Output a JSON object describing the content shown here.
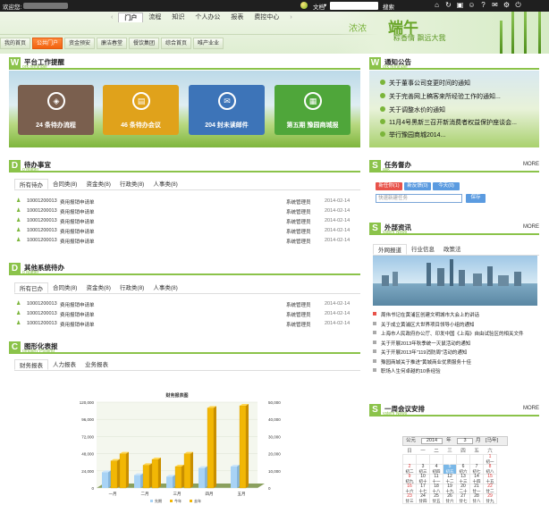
{
  "topbar": {
    "welcome": "欢迎您:",
    "doc_label": "文档",
    "search_button": "搜索"
  },
  "nav": {
    "items": [
      "门户",
      "流程",
      "知识",
      "个人办公",
      "报表",
      "费控中心"
    ]
  },
  "subnav": {
    "items": [
      "我的首页",
      "公共门户",
      "资金预安",
      "廉洁春堂",
      "餐饮集团",
      "综合首页",
      "唯产业业"
    ]
  },
  "logo": {
    "line1": "浓浓",
    "line2": "端午",
    "line3": "粽香情 飘远大我"
  },
  "reminder": {
    "title": "平台工作提醒",
    "subtitle": "ork reminder",
    "badge": "W",
    "tiles": [
      {
        "label": "24 条待办流程",
        "color": "#7a5f4e",
        "icon": "layers-icon",
        "glyph": "◈"
      },
      {
        "label": "46 条待办会议",
        "color": "#e0a21b",
        "icon": "chat-icon",
        "glyph": "▤"
      },
      {
        "label": "204 封未读邮件",
        "color": "#3d74b8",
        "icon": "mail-icon",
        "glyph": "✉"
      },
      {
        "label": "第五期 豫园商城报",
        "color": "#4fa63a",
        "icon": "book-icon",
        "glyph": "▦"
      }
    ]
  },
  "notice": {
    "title": "通知公告",
    "subtitle": "ork reminder",
    "badge": "W",
    "items": [
      "关于董事公司变更时间的通知",
      "关于完善网上稿客来所经验工作的通知...",
      "关于调整水价的通知",
      "11月4号黑新三召开新消费者权益保护座谈会...",
      "举行豫园商城2014..."
    ]
  },
  "todo": {
    "title": "待办事宜",
    "subtitle": "o Matter",
    "badge": "D",
    "tabs": [
      "所有待办",
      "合同类(8)",
      "资金类(8)",
      "行政类(8)",
      "人事类(8)"
    ],
    "rows": [
      {
        "code": "10001200013",
        "desc": "费用报销申请单",
        "who": "系统管理员",
        "date": "2014-02-14"
      },
      {
        "code": "10001200013",
        "desc": "费用报销申请单",
        "who": "系统管理员",
        "date": "2014-02-14"
      },
      {
        "code": "10001200013",
        "desc": "费用报销申请单",
        "who": "系统管理员",
        "date": "2014-02-14"
      },
      {
        "code": "10001200013",
        "desc": "费用报销申请单",
        "who": "系统管理员",
        "date": "2014-02-14"
      },
      {
        "code": "10001200013",
        "desc": "费用报销申请单",
        "who": "系统管理员",
        "date": "2014-02-14"
      }
    ]
  },
  "other": {
    "title": "其他系统待办",
    "subtitle": "o Matter",
    "badge": "D",
    "tabs": [
      "所有已办",
      "合同类(8)",
      "资金类(8)",
      "行政类(8)",
      "人事类(8)"
    ],
    "rows": [
      {
        "code": "10001200013",
        "desc": "费用报销申请单",
        "who": "系统管理员",
        "date": "2014-02-14"
      },
      {
        "code": "10001200013",
        "desc": "费用报销申请单",
        "who": "系统管理员",
        "date": "2014-02-14"
      },
      {
        "code": "10001200013",
        "desc": "费用报销申请单",
        "who": "系统管理员",
        "date": "2014-02-14"
      }
    ]
  },
  "graph": {
    "title": "图形化表报",
    "subtitle": "ompany Posting",
    "badge": "C",
    "tabs": [
      "财务报表",
      "人力报表",
      "业务报表"
    ]
  },
  "chart_data": {
    "type": "bar",
    "title": "财务报表图",
    "categories": [
      "一月",
      "二月",
      "三月",
      "四月",
      "五月"
    ],
    "series": [
      {
        "name": "先期",
        "values": [
          22000,
          18000,
          16000,
          28000,
          30000
        ],
        "color": "#a8d3f5"
      },
      {
        "name": "今年",
        "values": [
          38000,
          32000,
          30000,
          112000,
          115000
        ],
        "color": "#f2b705"
      },
      {
        "name": "去年",
        "values": [
          48000,
          40000,
          48000,
          0,
          0
        ],
        "color": "#f2b705"
      }
    ],
    "legend": [
      "先期",
      "今年",
      "去年"
    ],
    "left_ticks": [
      "120,000",
      "96,000",
      "72,000",
      "48,000",
      "24,000",
      "0"
    ],
    "right_ticks": [
      "50,000",
      "40,000",
      "30,000",
      "20,000",
      "10,000",
      "0"
    ],
    "ylim": [
      0,
      120000
    ],
    "legend_position": "bottom"
  },
  "task": {
    "title": "任务督办",
    "subtitle": "ask",
    "badge": "S",
    "more": "MORE",
    "pills": [
      "新任你(1)",
      "新反馈(0)",
      "今天(0)"
    ],
    "input_placeholder": "快速新建任务",
    "save": "保存"
  },
  "outside": {
    "title": "外部资讯",
    "subtitle": "ystem News",
    "badge": "S",
    "more": "MORE",
    "tabs": [
      "外网报道",
      "行业信息",
      "政策法"
    ],
    "news": [
      "周伟书记在黄浦区创建文明城市大会上的讲话",
      "关于成立黄浦区大世界项目领导小组的通知",
      "上海市人民政府办公厅、印发中国《上海》自由试验区的相关文件",
      "关于开展2013年秋季统一灭鼠活动的通知",
      "关于开展2013年\"119消防周\"活动的通知",
      "豫园商城关于推进\"黄城商业优质服务十佳",
      "职场人生何卓越的10条经验"
    ]
  },
  "meeting": {
    "title": "一周会议安排",
    "subtitle": "ystem News",
    "badge": "S",
    "more": "MORE",
    "cal_header": {
      "prefix": "公元",
      "year": "2014",
      "year_unit": "年",
      "month": "3",
      "month_unit": "月",
      "extra": "[马年]"
    },
    "weekdays": [
      "日",
      "一",
      "二",
      "三",
      "四",
      "五",
      "六"
    ],
    "weeks": [
      [
        "",
        "",
        "",
        "",
        "",
        "",
        "1 初一"
      ],
      [
        "2 初二",
        "3 初三",
        "4 初四",
        "5 初五",
        "6 初六",
        "7 初七",
        "8 初八"
      ],
      [
        "9 初九",
        "10 初十",
        "11 十一",
        "12 十二",
        "13 十三",
        "14 十四",
        "15 十五"
      ],
      [
        "16 十六",
        "17 十七",
        "18 十八",
        "19 十九",
        "20 二十",
        "21 廿一",
        "22 廿二"
      ],
      [
        "23 廿三",
        "24 廿四",
        "25 廿五",
        "26 廿六",
        "27 廿七",
        "28 廿八",
        "29 廿九"
      ]
    ]
  }
}
